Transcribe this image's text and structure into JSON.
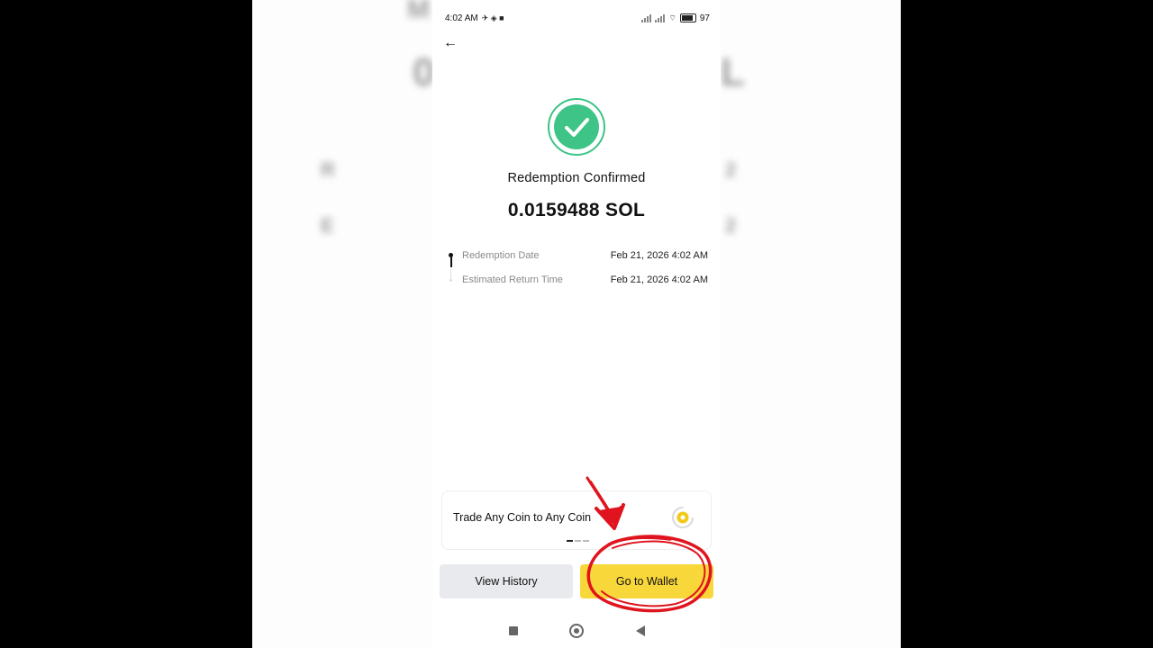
{
  "status_bar": {
    "time": "4:02 AM",
    "battery": "97"
  },
  "page": {
    "title": "Redemption Confirmed",
    "amount": "0.0159488 SOL",
    "timeline": [
      {
        "label": "Redemption Date",
        "value": "Feb 21, 2026 4:02 AM"
      },
      {
        "label": "Estimated Return Time",
        "value": "Feb 21, 2026 4:02 AM"
      }
    ]
  },
  "promo": {
    "text": "Trade Any Coin to Any Coin"
  },
  "buttons": {
    "history": "View History",
    "wallet": "Go to Wallet"
  },
  "colors": {
    "success": "#3dc486",
    "accent": "#f8d73a",
    "annotation": "#e0141e"
  },
  "icons": {
    "back": "arrow-left-icon",
    "success": "check-circle-icon",
    "promo": "coin-icon",
    "nav": [
      "square-nav-icon",
      "home-nav-icon",
      "back-nav-icon"
    ]
  }
}
